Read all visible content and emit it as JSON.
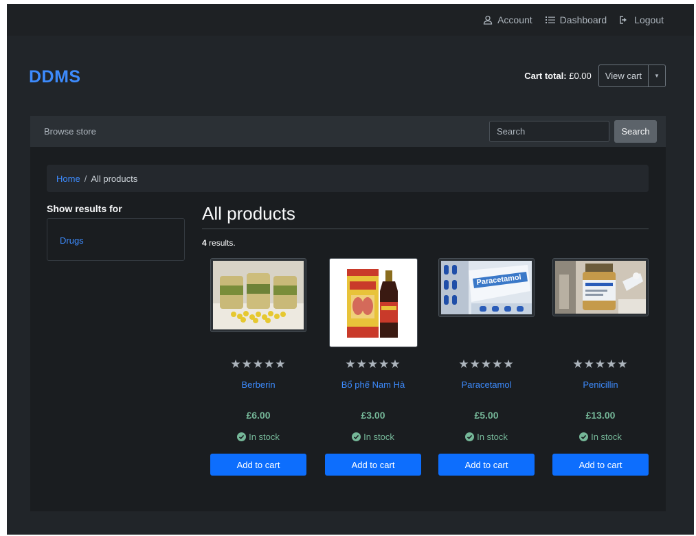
{
  "topbar": {
    "account_label": "Account",
    "dashboard_label": "Dashboard",
    "logout_label": "Logout"
  },
  "brand": "DDMS",
  "cart": {
    "total_label": "Cart total:",
    "total_value": "£0.00",
    "view_cart_label": "View cart"
  },
  "nav": {
    "browse_label": "Browse store",
    "search_placeholder": "Search",
    "search_button": "Search"
  },
  "breadcrumb": {
    "home": "Home",
    "separator": "/",
    "current": "All products"
  },
  "sidebar": {
    "title": "Show results for",
    "items": [
      {
        "label": "Drugs"
      }
    ]
  },
  "main": {
    "title": "All products",
    "results_count": "4",
    "results_suffix": "results."
  },
  "products": [
    {
      "name": "Berberin",
      "price": "£6.00",
      "stock": "In stock",
      "rating_stars": "★★★★★",
      "button": "Add to cart"
    },
    {
      "name": "Bổ phế Nam Hà",
      "price": "£3.00",
      "stock": "In stock",
      "rating_stars": "★★★★★",
      "button": "Add to cart"
    },
    {
      "name": "Paracetamol",
      "price": "£5.00",
      "stock": "In stock",
      "rating_stars": "★★★★★",
      "button": "Add to cart"
    },
    {
      "name": "Penicillin",
      "price": "£13.00",
      "stock": "In stock",
      "rating_stars": "★★★★★",
      "button": "Add to cart"
    }
  ],
  "image_text": {
    "paracetamol_box": "Paracetamol"
  },
  "colors": {
    "brand": "#3d8bfd",
    "link": "#3d8bfd",
    "price": "#75b798",
    "primary_button": "#0d6efd",
    "background": "#212529"
  }
}
